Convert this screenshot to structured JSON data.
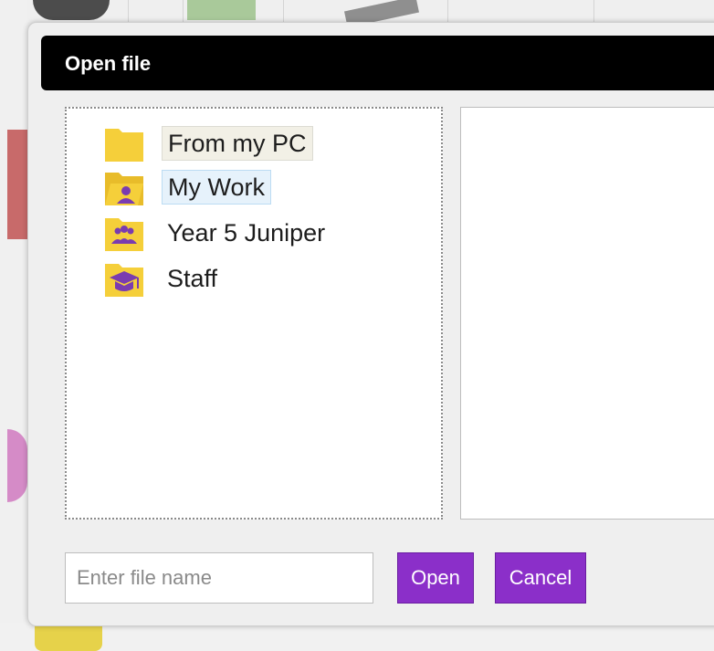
{
  "dialog": {
    "title": "Open file",
    "tree": [
      {
        "label": "From my PC",
        "icon": "folder-icon"
      },
      {
        "label": "My Work",
        "icon": "folder-user-icon"
      },
      {
        "label": "Year 5 Juniper",
        "icon": "folder-group-icon"
      },
      {
        "label": "Staff",
        "icon": "folder-graduation-cap-icon"
      }
    ],
    "file_name": {
      "value": "",
      "placeholder": "Enter file name"
    },
    "open_label": "Open",
    "cancel_label": "Cancel"
  },
  "colors": {
    "title_bar": "#000000",
    "button": "#8b2fc9",
    "folder": "#f5cf3a",
    "icon_accent": "#7a3cb0"
  }
}
